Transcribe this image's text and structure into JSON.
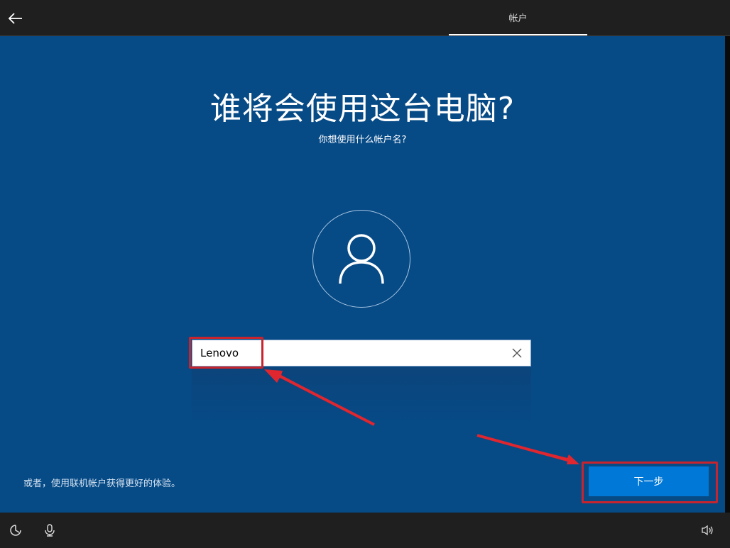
{
  "header": {
    "tab_label": "帐户"
  },
  "main": {
    "title": "谁将会使用这台电脑?",
    "subtitle": "你想使用什么帐户名?",
    "username_value": "Lenovo",
    "online_link": "或者，使用联机帐户获得更好的体验。",
    "next_label": "下一步"
  },
  "colors": {
    "background": "#064a86",
    "accent": "#0078d7",
    "annotation": "#c8242e"
  },
  "icons": {
    "back": "back-arrow-icon",
    "avatar": "user-icon",
    "clear": "close-icon",
    "ease_of_access": "ease-of-access-icon",
    "microphone": "microphone-icon",
    "volume": "volume-icon"
  }
}
